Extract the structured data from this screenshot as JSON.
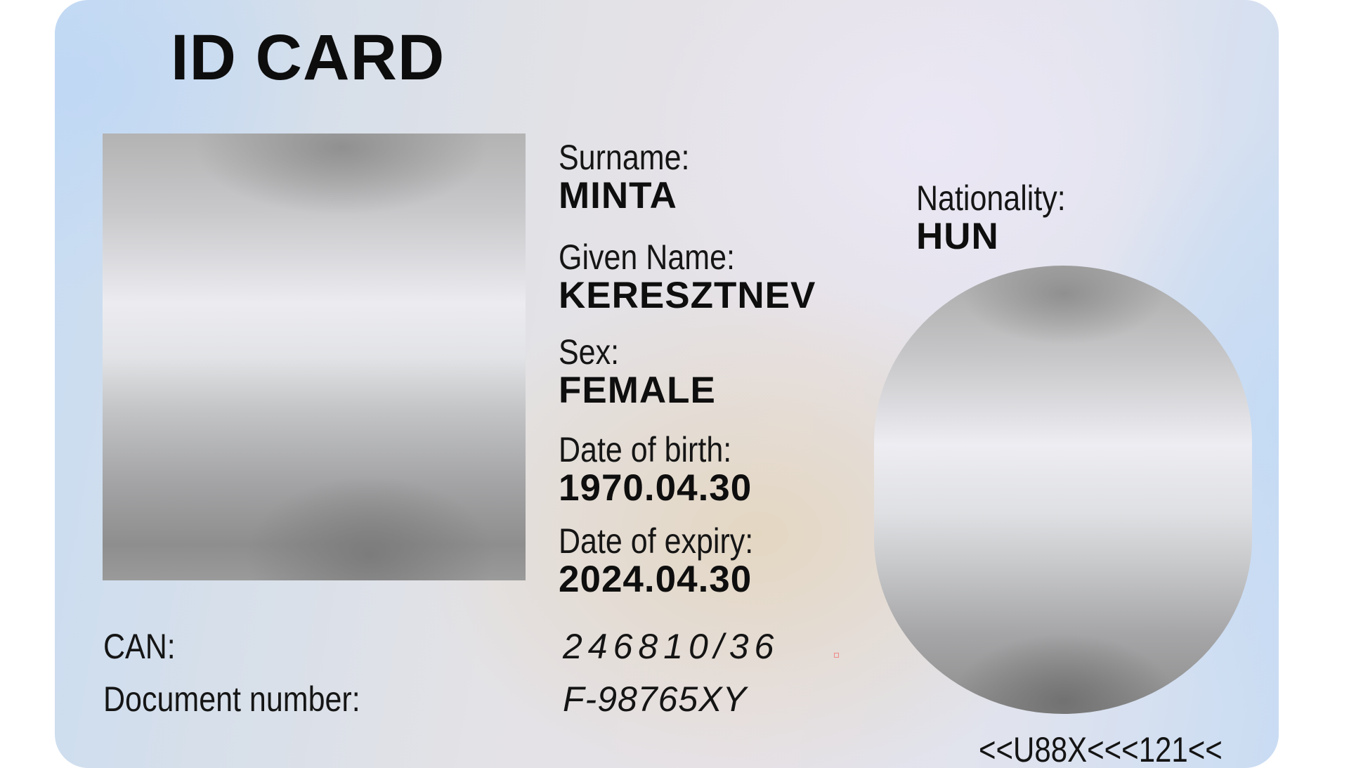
{
  "card": {
    "title": "ID CARD",
    "fields": {
      "surname": {
        "label": "Surname:",
        "value": "MINTA"
      },
      "given_name": {
        "label": "Given Name:",
        "value": "KERESZTNEV"
      },
      "sex": {
        "label": "Sex:",
        "value": "FEMALE"
      },
      "date_of_birth": {
        "label": "Date of birth:",
        "value": "1970.04.30"
      },
      "date_of_expiry": {
        "label": "Date of expiry:",
        "value": "2024.04.30"
      },
      "nationality": {
        "label": "Nationality:",
        "value": "HUN"
      }
    },
    "can": {
      "label": "CAN:",
      "value": "246810/36"
    },
    "document_number": {
      "label": "Document number:",
      "value": "F-98765XY"
    },
    "mrz_line": "<<U88X<<<121<<"
  }
}
